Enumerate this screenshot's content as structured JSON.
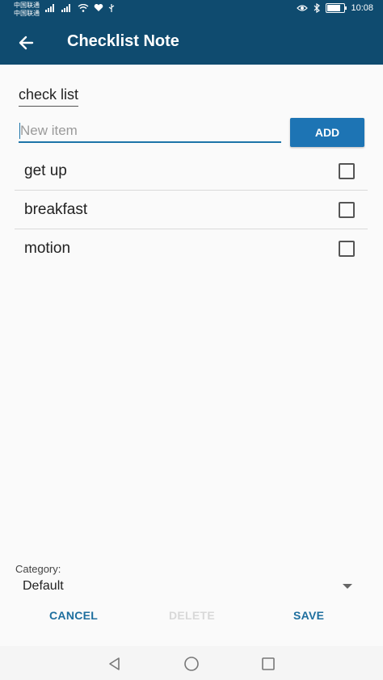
{
  "status_bar": {
    "carrier_line1": "中国联通",
    "carrier_line2": "中国联通",
    "time": "10:08",
    "battery_level": 0.8
  },
  "app_bar": {
    "title": "Checklist Note",
    "back_icon": "arrow-back-icon",
    "background_color": "#0f4b6f"
  },
  "note": {
    "title": "check list"
  },
  "new_item": {
    "value": "",
    "placeholder": "New item",
    "add_label": "ADD",
    "accent_color": "#1d74b4"
  },
  "items": [
    {
      "label": "get up",
      "checked": false
    },
    {
      "label": "breakfast",
      "checked": false
    },
    {
      "label": "motion",
      "checked": false
    }
  ],
  "category": {
    "label": "Category:",
    "selected": "Default"
  },
  "actions": {
    "cancel": "CANCEL",
    "delete": "DELETE",
    "save": "SAVE"
  },
  "nav_bar": {
    "back_icon": "triangle-back-icon",
    "home_icon": "circle-home-icon",
    "recents_icon": "square-recents-icon"
  }
}
